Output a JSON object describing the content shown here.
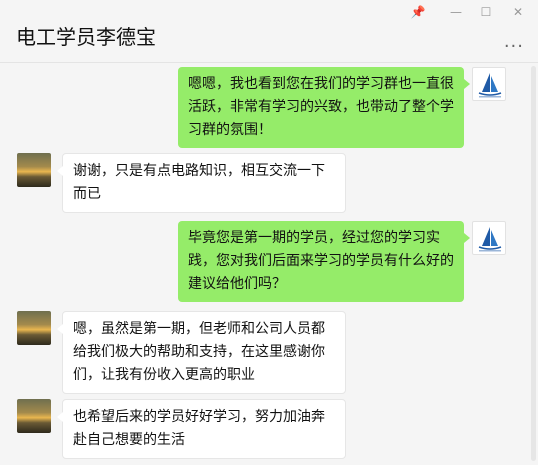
{
  "window": {
    "title": "电工学员李德宝",
    "controls": {
      "pin": "📌",
      "minimize": "—",
      "maximize": "☐",
      "close": "✕"
    },
    "more_icon": "···"
  },
  "messages": [
    {
      "side": "right",
      "text": "嗯嗯，我也看到您在我们的学习群也一直很活跃，非常有学习的兴致，也带动了整个学习群的氛围！"
    },
    {
      "side": "left",
      "text": "谢谢，只是有点电路知识，相互交流一下而已"
    },
    {
      "side": "right",
      "text": "毕竟您是第一期的学员，经过您的学习实践，您对我们后面来学习的学员有什么好的建议给他们吗？"
    },
    {
      "side": "left",
      "text": "嗯，虽然是第一期，但老师和公司人员都给我们极大的帮助和支持，在这里感谢你们，让我有份收入更高的职业"
    },
    {
      "side": "left",
      "text": "也希望后来的学员好好学习，努力加油奔赴自己想要的生活"
    }
  ],
  "colors": {
    "my_bubble": "#95ec69",
    "their_bubble": "#ffffff",
    "background": "#f5f5f5"
  }
}
